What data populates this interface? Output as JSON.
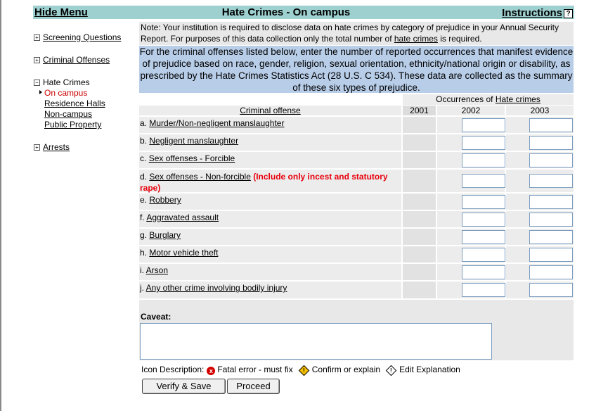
{
  "header": {
    "hide_menu": "Hide Menu",
    "title": "Hate Crimes - On campus",
    "instructions": "Instructions",
    "help_glyph": "?"
  },
  "menu": {
    "screening": "Screening Questions",
    "criminal": "Criminal Offenses",
    "hate": "Hate Crimes",
    "hate_subs": [
      "On campus",
      "Residence Halls",
      "Non-campus",
      "Public Property"
    ],
    "arrests": "Arrests"
  },
  "note": {
    "part1": "Note: Your institution is required to disclose data on hate crimes by category of prejudice in your Annual Security Report. For purposes of this data collection only the total number of ",
    "link": "hate crimes",
    "part2": " is required."
  },
  "instruction_text": "For the criminal offenses listed below, enter the number of reported occurrences that manifest evidence of prejudice based on race, gender, religion, sexual orientation, ethnicity/national origin or disability, as prescribed by the Hate Crimes Statistics Act (28 U.S. C 534). These data are collected as the summary of these six types of prejudice.",
  "table": {
    "occurrences_prefix": "Occurrences of ",
    "occurrences_link": "Hate crimes",
    "col_offense": "Criminal offense",
    "years": [
      "2001",
      "2002",
      "2003"
    ],
    "rows": [
      {
        "letter": "a.",
        "label": "Murder/Non-negligent manslaughter"
      },
      {
        "letter": "b.",
        "label": "Negligent manslaughter"
      },
      {
        "letter": "c.",
        "label": "Sex offenses - Forcible"
      },
      {
        "letter": "d.",
        "label": "Sex offenses - Non-forcible",
        "note": "(Include only incest and statutory rape)"
      },
      {
        "letter": "e.",
        "label": "Robbery"
      },
      {
        "letter": "f.",
        "label": "Aggravated assault"
      },
      {
        "letter": "g.",
        "label": "Burglary"
      },
      {
        "letter": "h.",
        "label": "Motor vehicle theft"
      },
      {
        "letter": "i.",
        "label": "Arson"
      },
      {
        "letter": "j.",
        "label": "Any other crime involving bodily injury"
      }
    ]
  },
  "caveat": {
    "label": "Caveat:",
    "value": ""
  },
  "icons": {
    "desc_label": "Icon Description:",
    "fatal": "Fatal error - must fix",
    "fatal_glyph": "x",
    "confirm": "Confirm or explain",
    "edit": "Edit Explanation",
    "diamond_glyph": "!"
  },
  "buttons": {
    "verify": "Verify & Save",
    "proceed": "Proceed"
  },
  "colors": {
    "header_bg": "#9ed0d0",
    "instruction_bg": "#b8cde8",
    "error_red": "#e8000b",
    "active_link": "#cc0000"
  }
}
